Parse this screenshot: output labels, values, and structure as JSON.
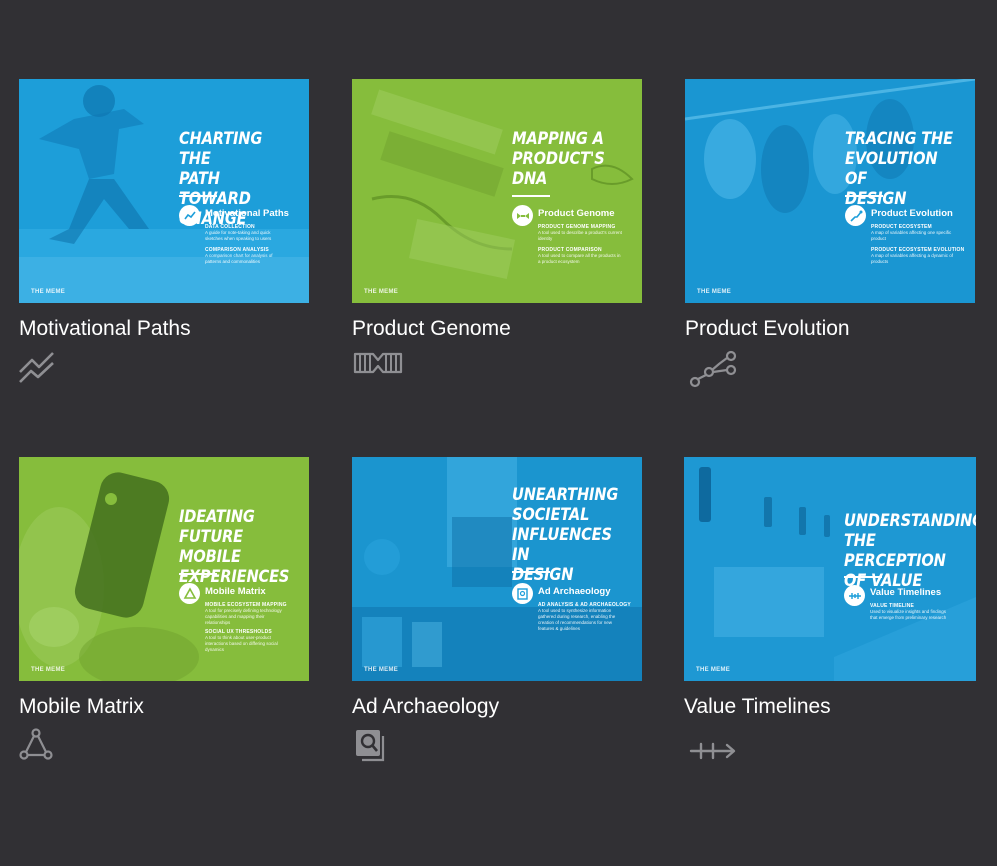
{
  "cards": [
    {
      "title": "Motivational Paths",
      "icon": "trend-lines-icon",
      "thumb_color": "#1d9ed9",
      "headline": "CHARTING THE\nPATH TOWARD\nCHANGE",
      "badge_label": "Motivational Paths",
      "sections": [
        {
          "title": "DATA COLLECTION",
          "text": "A guide for note-taking and quick sketches when speaking to users"
        },
        {
          "title": "COMPARISON ANALYSIS",
          "text": "A comparison chart for analysis of patterns and commonalities"
        }
      ],
      "logo": "THE MEME",
      "footnote": ""
    },
    {
      "title": "Product Genome",
      "icon": "dna-strand-icon",
      "thumb_color": "#86bd3c",
      "headline": "MAPPING A\nPRODUCT'S\nDNA",
      "badge_label": "Product Genome",
      "sections": [
        {
          "title": "PRODUCT GENOME MAPPING",
          "text": "A tool used to describe a product's current identity"
        },
        {
          "title": "PRODUCT COMPARISON",
          "text": "A tool used to compare all the products in a product ecosystem"
        }
      ],
      "logo": "THE MEME",
      "footnote": ""
    },
    {
      "title": "Product Evolution",
      "icon": "evolution-branch-icon",
      "thumb_color": "#1d9ed9",
      "headline": "TRACING THE\nEVOLUTION OF\nDESIGN",
      "badge_label": "Product Evolution",
      "sections": [
        {
          "title": "PRODUCT ECOSYSTEM",
          "text": "A map of variables affecting one specific product"
        },
        {
          "title": "PRODUCT ECOSYSTEM EVOLUTION",
          "text": "A map of variables affecting a dynamic of products"
        }
      ],
      "logo": "THE MEME",
      "footnote": ""
    },
    {
      "title": "Mobile Matrix",
      "icon": "triangle-network-icon",
      "thumb_color": "#86bd3c",
      "headline": "IDEATING\nFUTURE MOBILE\nEXPERIENCES",
      "badge_label": "Mobile Matrix",
      "sections": [
        {
          "title": "MOBILE ECOSYSTEM MAPPING",
          "text": "A tool for precisely defining technology capabilities and mapping their relationships"
        },
        {
          "title": "SOCIAL UX THRESHOLDS",
          "text": "A tool to think about user-product interactions based on differing social dynamics"
        }
      ],
      "logo": "THE MEME",
      "footnote": ""
    },
    {
      "title": "Ad Archaeology",
      "icon": "magnifier-document-icon",
      "thumb_color": "#1d9ed9",
      "headline": "UNEARTHING\nSOCIETAL\nINFLUENCES IN\nDESIGN",
      "badge_label": "Ad Archaeology",
      "sections": [
        {
          "title": "AD ANALYSIS & AD ARCHAEOLOGY",
          "text": "A tool used to synthesize information gathered during research, enabling the creation of recommendations for new features & guidelines"
        }
      ],
      "logo": "THE MEME",
      "footnote": ""
    },
    {
      "title": "Value Timelines",
      "icon": "timeline-arrow-icon",
      "thumb_color": "#1d9ed9",
      "headline": "UNDERSTANDING\nTHE PERCEPTION\nOF VALUE",
      "badge_label": "Value Timelines",
      "sections": [
        {
          "title": "VALUE TIMELINE",
          "text": "Used to visualize insights and findings that emerge from preliminary research"
        }
      ],
      "logo": "THE MEME",
      "footnote": ""
    }
  ]
}
